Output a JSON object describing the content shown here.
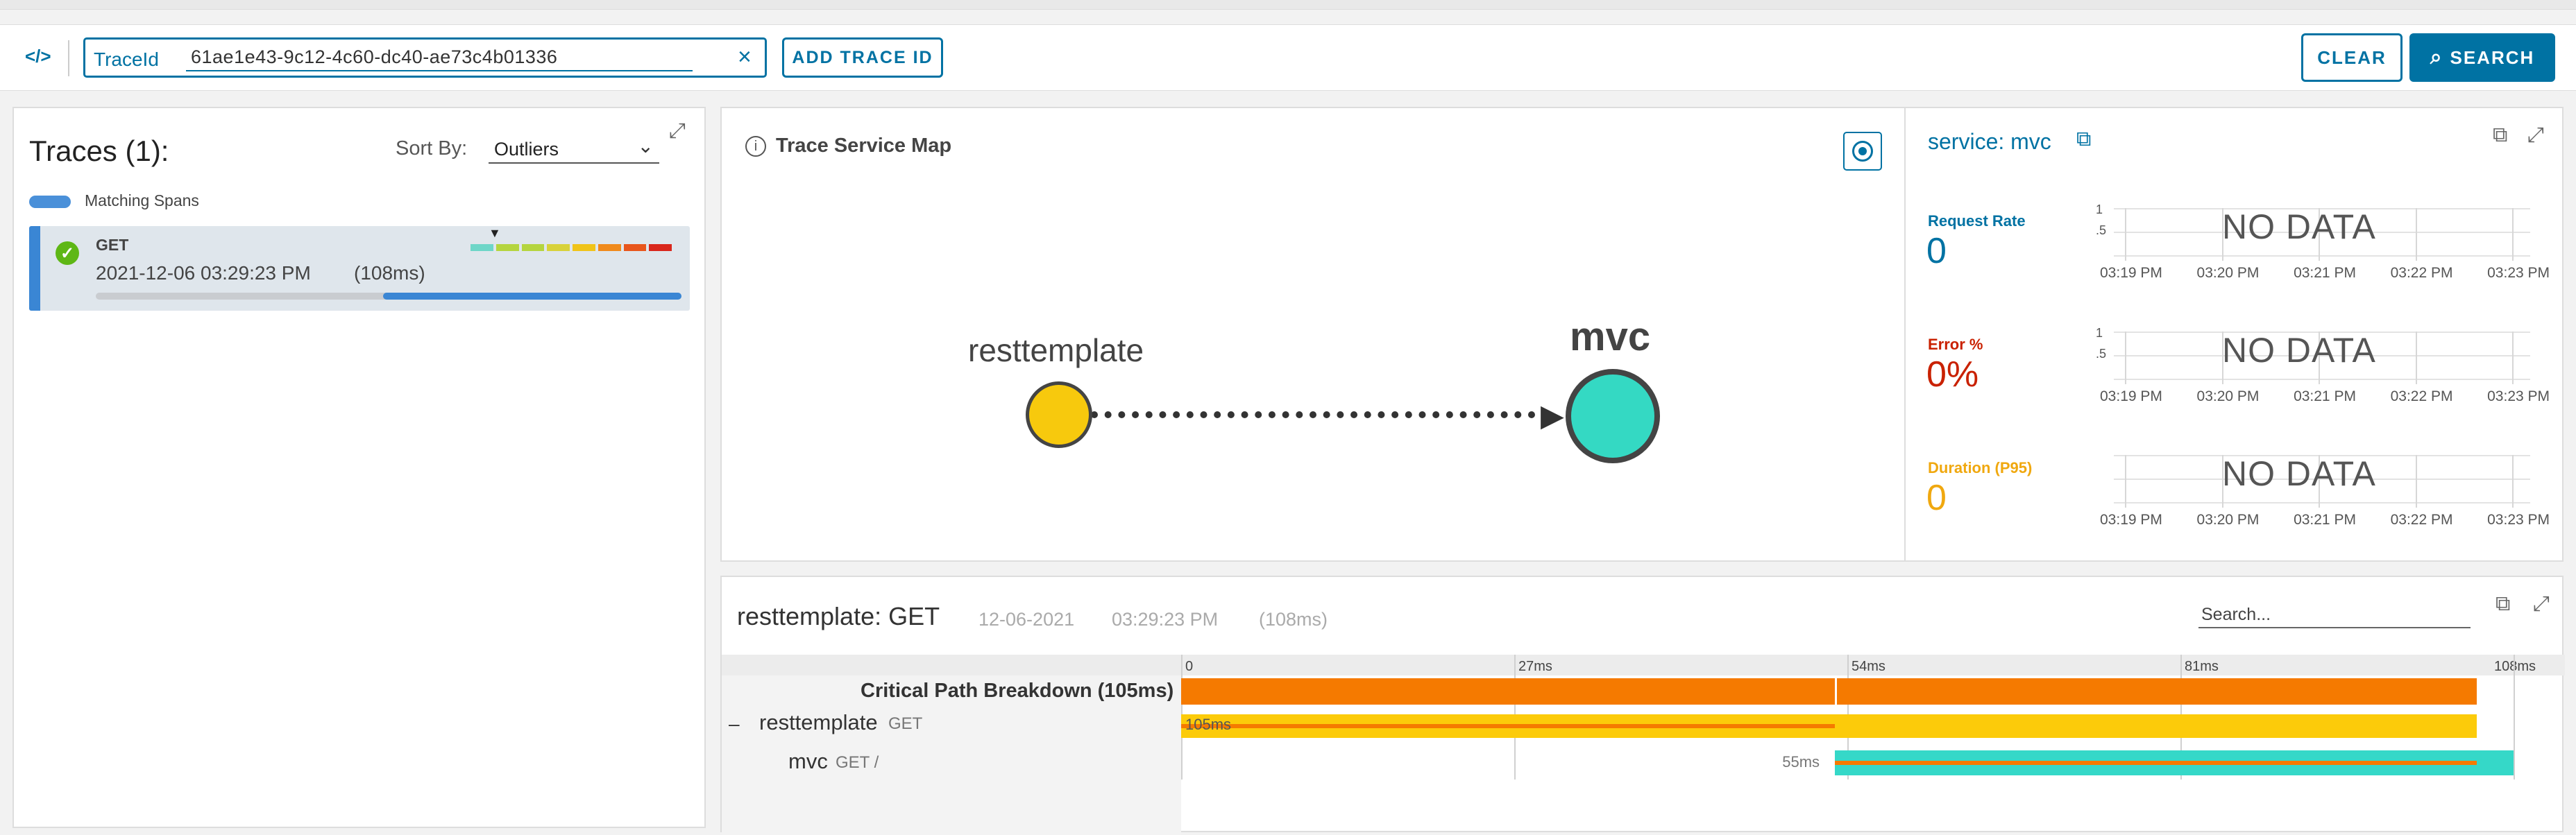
{
  "search_bar": {
    "code_icon": "</>",
    "field_label": "TraceId",
    "field_value": "61ae1e43-9c12-4c60-dc40-ae73c4b01336",
    "add_label": "ADD TRACE ID",
    "clear_label": "CLEAR",
    "search_label": "SEARCH"
  },
  "traces": {
    "title": "Traces (1):",
    "sort_label": "Sort By:",
    "sort_value": "Outliers",
    "legend_label": "Matching Spans",
    "items": [
      {
        "name": "GET",
        "time": "2021-12-06 03:29:23 PM",
        "duration": "(108ms)"
      }
    ],
    "colors": [
      "#6ed6c8",
      "#b5d53f",
      "#b5d53f",
      "#d8d23a",
      "#f0c419",
      "#f08a1c",
      "#e8561c",
      "#d9271c"
    ]
  },
  "service_map": {
    "title": "Trace Service Map",
    "nodes": [
      {
        "label": "resttemplate",
        "color": "#f7c90d"
      },
      {
        "label": "mvc",
        "color": "#34d9c3"
      }
    ]
  },
  "service_detail": {
    "title": "service: mvc",
    "metrics": [
      {
        "label": "Request Rate",
        "value": "0",
        "color": "#0072a3"
      },
      {
        "label": "Error %",
        "value": "0%",
        "color": "#c92100"
      },
      {
        "label": "Duration (P95)",
        "value": "0",
        "color": "#f0a80f"
      }
    ],
    "no_data": "NO DATA",
    "y_ticks": [
      "1",
      ".5"
    ],
    "x_ticks": [
      "03:19 PM",
      "03:20 PM",
      "03:21 PM",
      "03:22 PM",
      "03:23 PM"
    ]
  },
  "trace_detail": {
    "title": "resttemplate: GET",
    "date": "12-06-2021",
    "time": "03:29:23 PM",
    "duration": "(108ms)",
    "search_placeholder": "Search...",
    "ticks": [
      "0",
      "27ms",
      "54ms",
      "81ms",
      "108ms"
    ],
    "critical_path_label": "Critical Path Breakdown (105ms)",
    "rows": [
      {
        "toggle": "–",
        "service": "resttemplate",
        "op": "GET",
        "bar_label": "105ms",
        "color": "#fccb0a"
      },
      {
        "toggle": "",
        "service": "mvc",
        "op": "GET /",
        "bar_label": "55ms",
        "color": "#35d8c8"
      }
    ],
    "critical_color": "#f57a00"
  }
}
